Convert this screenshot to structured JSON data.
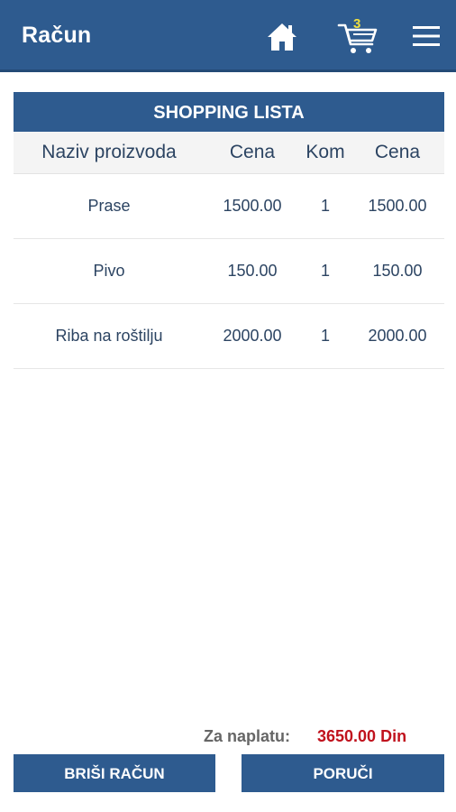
{
  "appbar": {
    "title": "Račun",
    "cart_count": "3",
    "icons": [
      "home-icon",
      "cart-icon",
      "menu-icon"
    ]
  },
  "table": {
    "title": "SHOPPING LISTA",
    "headers": [
      "Naziv proizvoda",
      "Cena",
      "Kom",
      "Cena"
    ],
    "rows": [
      {
        "name": "Prase",
        "price": "1500.00",
        "qty": "1",
        "total": "1500.00"
      },
      {
        "name": "Pivo",
        "price": "150.00",
        "qty": "1",
        "total": "150.00"
      },
      {
        "name": "Riba na roštilju",
        "price": "2000.00",
        "qty": "1",
        "total": "2000.00"
      }
    ]
  },
  "footer": {
    "total_label": "Za naplatu:",
    "total_value": "3650.00 Din",
    "delete_label": "BRIŠI RAČUN",
    "order_label": "PORUČI"
  },
  "colors": {
    "primary": "#2e5b8f",
    "text": "#2c4462",
    "total": "#c0121d",
    "badge": "#f0e040"
  }
}
